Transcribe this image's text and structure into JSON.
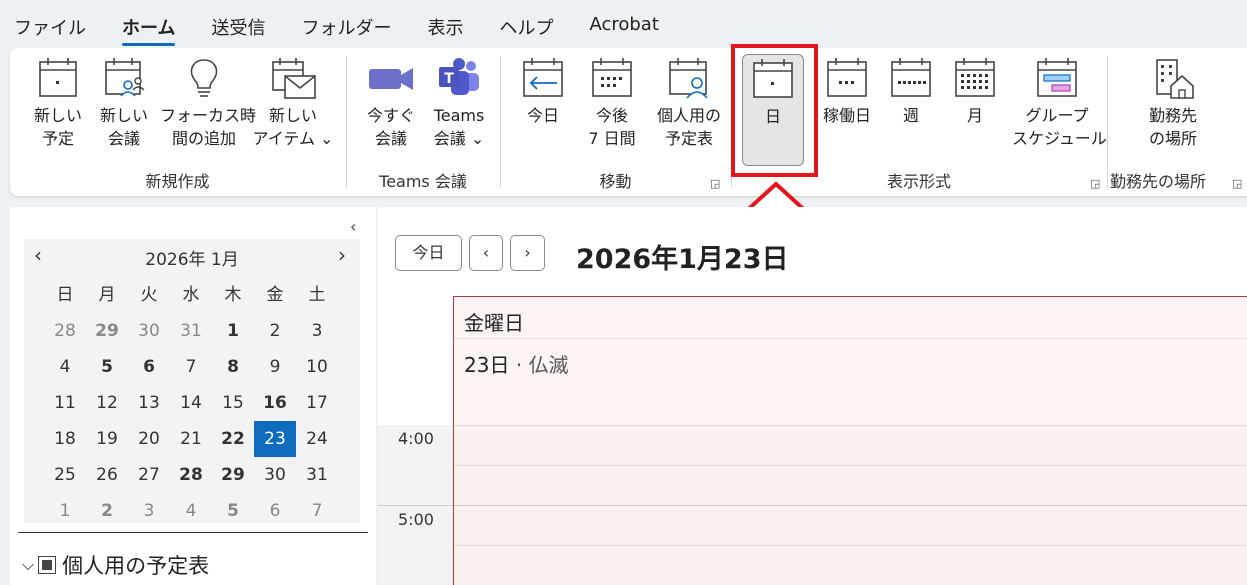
{
  "menu": [
    "ファイル",
    "ホーム",
    "送受信",
    "フォルダー",
    "表示",
    "ヘルプ",
    "Acrobat"
  ],
  "ribbon": {
    "new_group": {
      "label": "新規作成",
      "buttons": [
        {
          "line1": "新しい",
          "line2": "予定"
        },
        {
          "line1": "新しい",
          "line2": "会議"
        },
        {
          "line1": "フォーカス時",
          "line2": "間の追加"
        },
        {
          "line1": "新しい",
          "line2": "アイテム ⌄"
        }
      ]
    },
    "teams_group": {
      "label": "Teams 会議",
      "buttons": [
        {
          "line1": "今すぐ",
          "line2": "会議"
        },
        {
          "line1": "Teams",
          "line2": "会議 ⌄"
        }
      ]
    },
    "move_group": {
      "label": "移動",
      "buttons": [
        {
          "line1": "今日",
          "line2": ""
        },
        {
          "line1": "今後",
          "line2": "7 日間"
        },
        {
          "line1": "個人用の",
          "line2": "予定表"
        }
      ]
    },
    "view_group": {
      "label": "表示形式",
      "buttons": [
        {
          "line1": "日",
          "line2": ""
        },
        {
          "line1": "稼働日",
          "line2": ""
        },
        {
          "line1": "週",
          "line2": ""
        },
        {
          "line1": "月",
          "line2": ""
        },
        {
          "line1": "グループ",
          "line2": "スケジュール"
        }
      ]
    },
    "workplace_group": {
      "label": "勤務先の場所",
      "buttons": [
        {
          "line1": "勤務先",
          "line2": "の場所"
        }
      ]
    }
  },
  "mini_calendar": {
    "title": "2026年 1月",
    "weekdays": [
      "日",
      "月",
      "火",
      "水",
      "木",
      "金",
      "土"
    ],
    "weeks": [
      [
        {
          "d": "28",
          "o": true
        },
        {
          "d": "29",
          "o": true,
          "b": true
        },
        {
          "d": "30",
          "o": true
        },
        {
          "d": "31",
          "o": true
        },
        {
          "d": "1",
          "b": true
        },
        {
          "d": "2"
        },
        {
          "d": "3"
        }
      ],
      [
        {
          "d": "4"
        },
        {
          "d": "5",
          "b": true
        },
        {
          "d": "6",
          "b": true
        },
        {
          "d": "7"
        },
        {
          "d": "8",
          "b": true
        },
        {
          "d": "9"
        },
        {
          "d": "10"
        }
      ],
      [
        {
          "d": "11"
        },
        {
          "d": "12"
        },
        {
          "d": "13"
        },
        {
          "d": "14"
        },
        {
          "d": "15"
        },
        {
          "d": "16",
          "b": true
        },
        {
          "d": "17"
        }
      ],
      [
        {
          "d": "18"
        },
        {
          "d": "19"
        },
        {
          "d": "20"
        },
        {
          "d": "21"
        },
        {
          "d": "22",
          "b": true
        },
        {
          "d": "23",
          "t": true
        },
        {
          "d": "24"
        }
      ],
      [
        {
          "d": "25"
        },
        {
          "d": "26"
        },
        {
          "d": "27"
        },
        {
          "d": "28",
          "b": true
        },
        {
          "d": "29",
          "b": true
        },
        {
          "d": "30"
        },
        {
          "d": "31"
        }
      ],
      [
        {
          "d": "1",
          "o": true
        },
        {
          "d": "2",
          "o": true,
          "b": true
        },
        {
          "d": "3",
          "o": true
        },
        {
          "d": "4",
          "o": true
        },
        {
          "d": "5",
          "o": true,
          "b": true
        },
        {
          "d": "6",
          "o": true
        },
        {
          "d": "7",
          "o": true
        }
      ]
    ]
  },
  "calendar_section": "個人用の予定表",
  "main": {
    "today_button": "今日",
    "date_title": "2026年1月23日",
    "day_name": "金曜日",
    "day_number": "23日",
    "rokuyo": "· 仏滅",
    "times": [
      "4:00",
      "5:00"
    ]
  },
  "colors": {
    "accent": "#0f6cbd",
    "highlight": "#e3161d"
  }
}
